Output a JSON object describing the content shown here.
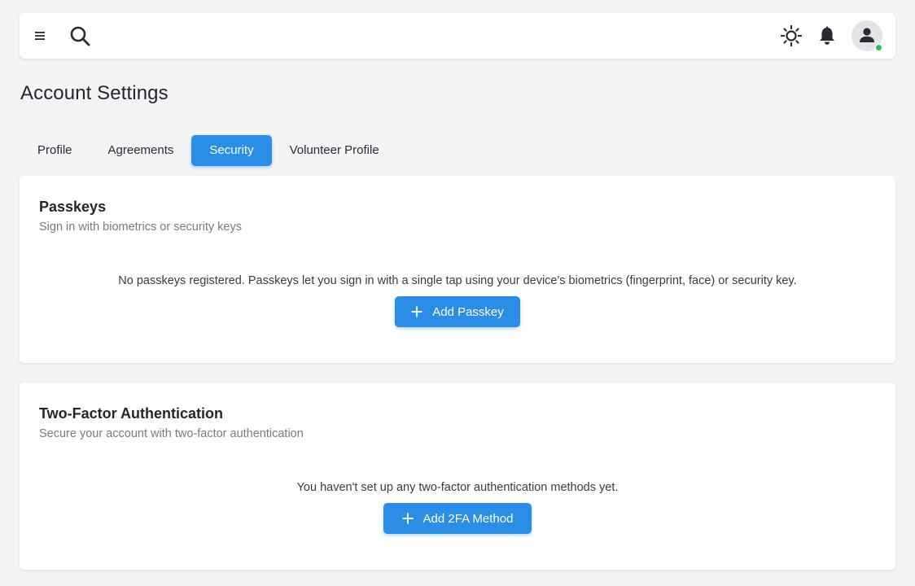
{
  "header": {
    "menu_icon": "hamburger-menu-icon",
    "search_icon": "search-icon",
    "theme_icon": "sun-icon",
    "notifications_icon": "bell-icon",
    "avatar_icon": "user-avatar-icon",
    "status_color": "#2ebd5f"
  },
  "page": {
    "title": "Account Settings"
  },
  "tabs": [
    {
      "label": "Profile",
      "active": false
    },
    {
      "label": "Agreements",
      "active": false
    },
    {
      "label": "Security",
      "active": true
    },
    {
      "label": "Volunteer Profile",
      "active": false
    }
  ],
  "passkeys": {
    "title": "Passkeys",
    "subtitle": "Sign in with biometrics or security keys",
    "message": "No passkeys registered. Passkeys let you sign in with a single tap using your device's biometrics (fingerprint, face) or security key.",
    "button_label": "Add Passkey"
  },
  "two_factor": {
    "title": "Two-Factor Authentication",
    "subtitle": "Secure your account with two-factor authentication",
    "message": "You haven't set up any two-factor authentication methods yet.",
    "button_label": "Add 2FA Method"
  },
  "colors": {
    "accent": "#2a8de6",
    "background": "#f4f4f6",
    "card": "#ffffff"
  }
}
